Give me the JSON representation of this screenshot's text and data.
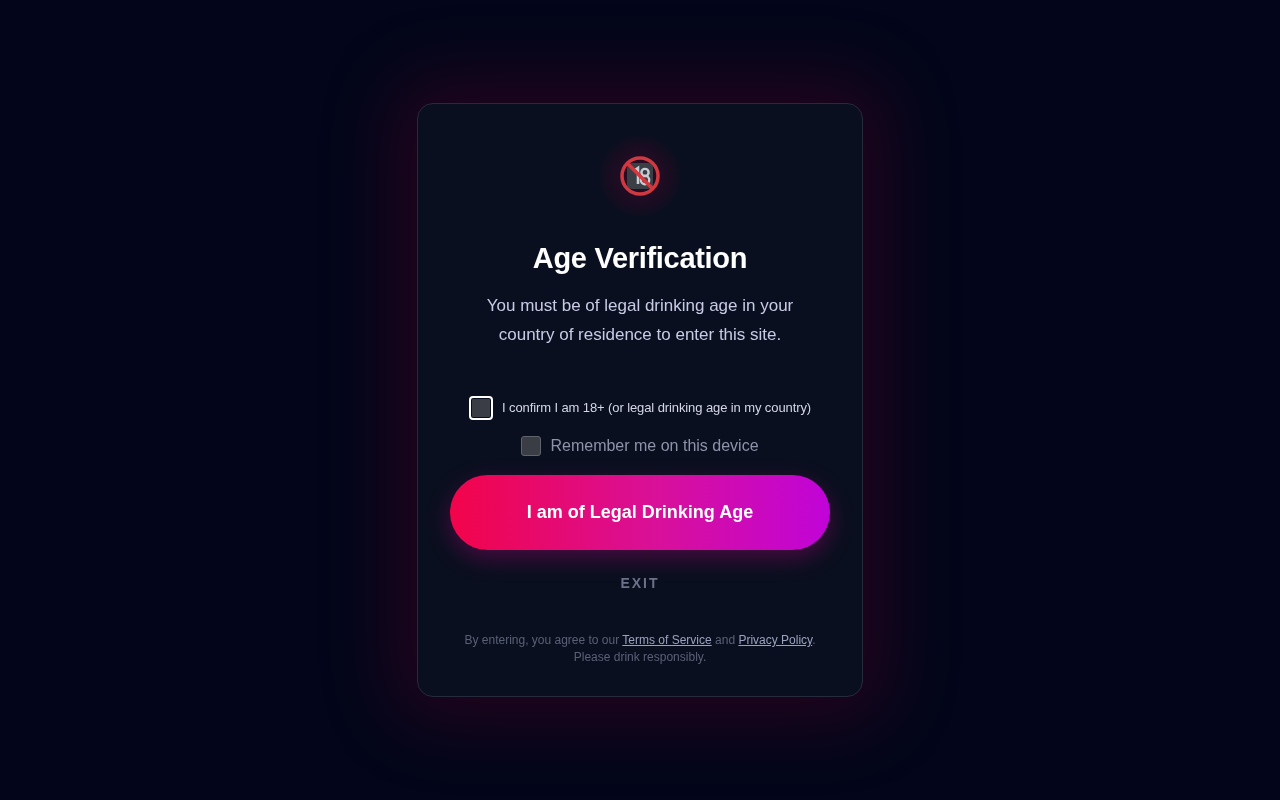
{
  "dialog": {
    "title": "Age Verification",
    "message": "You must be of legal drinking age in your country of residence to enter this site.",
    "checks": [
      {
        "kind": "consent",
        "label": "I confirm I am 18+ (or legal drinking age in my country)",
        "checked": false,
        "focused": true
      },
      {
        "kind": "option",
        "label": "Remember me on this device",
        "checked": false,
        "focused": false
      }
    ],
    "primary_button": "I am of Legal Drinking Age",
    "exit_button": "EXIT",
    "footer": {
      "parts": [
        {
          "kind": "text",
          "text": "By entering, you agree to our "
        },
        {
          "kind": "link",
          "text": "Terms of Service"
        },
        {
          "kind": "text",
          "text": " and "
        },
        {
          "kind": "link",
          "text": "Privacy Policy"
        },
        {
          "kind": "text",
          "text": "."
        }
      ],
      "note": "Please drink responsibly."
    }
  }
}
